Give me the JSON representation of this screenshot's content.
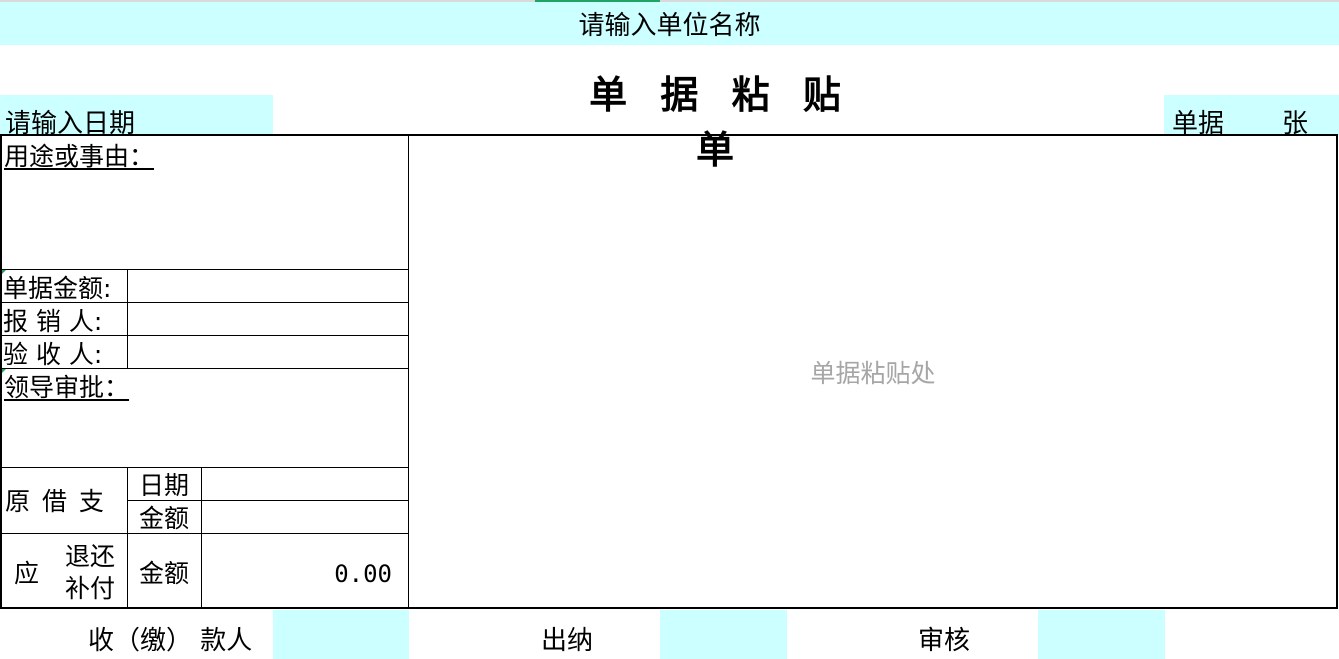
{
  "header": {
    "unit_name": "请输入单位名称",
    "title": "单 据 粘 贴 单",
    "date": "请输入日期",
    "count_prefix": "单据",
    "count_suffix": "张"
  },
  "form": {
    "purpose_label": "用途或事由：",
    "amount_label": "单据金额:",
    "reimburser_label": "报 销 人:",
    "inspector_label": "验 收 人:",
    "approval_label": "领导审批：",
    "original_borrow_label": "原 借 支",
    "date_label": "日期",
    "amount_label2": "金额",
    "should_label": "应",
    "refund_label": "退还",
    "supplement_label": "补付",
    "amount_label3": "金额",
    "balance_value": "0.00"
  },
  "paste_area": {
    "label": "单据粘贴处"
  },
  "footer": {
    "payee_label": "收（缴） 款人",
    "cashier_label": "出纳",
    "review_label": "审核"
  },
  "colors": {
    "input_cell": "#ccffff",
    "border": "#000000",
    "placeholder": "#a6a6a6",
    "selection": "#21a366"
  }
}
